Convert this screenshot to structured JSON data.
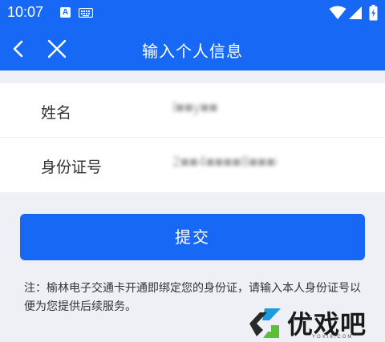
{
  "status_bar": {
    "time": "10:07",
    "icons": [
      "a-app-icon",
      "keyboard-icon",
      "wifi-icon",
      "signal-icon",
      "battery-charging-icon"
    ]
  },
  "nav": {
    "title": "输入个人信息",
    "back_icon": "chevron-left-icon",
    "close_icon": "close-icon"
  },
  "form": {
    "name_label": "姓名",
    "name_value": "l■■y■■",
    "id_label": "身份证号",
    "id_value": "2■■4■■■■8■■■■■"
  },
  "submit_label": "提交",
  "note": "注：榆林电子交通卡开通即绑定您的身份证，请输入本人身份证号以便为您提供后续服务。",
  "watermark": {
    "brand_text": "优戏吧",
    "url_text": "YOXI8.COM"
  },
  "colors": {
    "primary": "#1769f5",
    "background": "#eef0f5"
  }
}
